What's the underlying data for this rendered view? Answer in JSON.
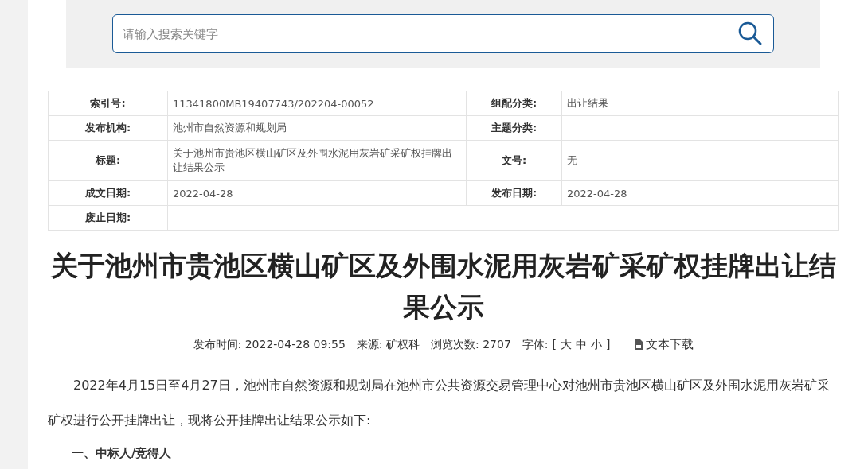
{
  "search": {
    "placeholder": "请输入搜索关键字"
  },
  "meta_table": [
    [
      {
        "label": "索引号:",
        "value": "11341800MB19407743/202204-00052"
      },
      {
        "label": "组配分类:",
        "value": "出让结果"
      }
    ],
    [
      {
        "label": "发布机构:",
        "value": "池州市自然资源和规划局"
      },
      {
        "label": "主题分类:"
      }
    ],
    [
      {
        "label": "标题:",
        "value": "关于池州市贵池区横山矿区及外围水泥用灰岩矿采矿权挂牌出让结果公示"
      },
      {
        "label": "文号:",
        "value": "无"
      }
    ],
    [
      {
        "label": "成文日期:",
        "value": "2022-04-28"
      },
      {
        "label": "发布日期:",
        "value": "2022-04-28"
      }
    ],
    [
      {
        "label": "废止日期:"
      }
    ]
  ],
  "article": {
    "title": "关于池州市贵池区横山矿区及外围水泥用灰岩矿采矿权挂牌出让结果公示",
    "info": [
      {
        "label": "发布时间:",
        "value": "2022-04-28 09:55"
      },
      {
        "label": "来源:",
        "value": "矿权科"
      },
      {
        "label": "浏览次数:",
        "value": "2707"
      }
    ],
    "font_label": "字体:",
    "bracket_open": "[",
    "bracket_close": "]",
    "font_sizes": [
      "大",
      "中",
      "小"
    ],
    "download": "文本下载",
    "paragraph": "2022年4月15日至4月27日，池州市自然资源和规划局在池州市公共资源交易管理中心对池州市贵池区横山矿区及外围水泥用灰岩矿采矿权进行公开挂牌出让，现将公开挂牌出让结果公示如下:",
    "heading": "一、中标人/竞得人"
  }
}
